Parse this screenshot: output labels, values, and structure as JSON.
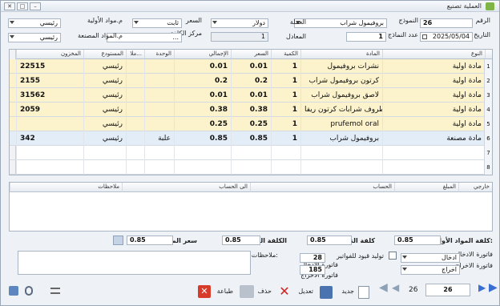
{
  "window": {
    "title": "العملية تصنيع",
    "min": "–",
    "max": "□",
    "close": "✕"
  },
  "header": {
    "number_label": "الرقم",
    "number_value": "26",
    "form_label": "النموذج",
    "form_value": "بروفيمول شراب",
    "date_label": "التاريخ",
    "date_value": "2025/05/04",
    "form_count_label": "عدد النماذج",
    "form_count_value": "1",
    "currency_label": "العملة",
    "currency_value": "دولار",
    "rate_label": "المعادل",
    "rate_value": "1",
    "price_label": "السعر",
    "price_value": "ثابت",
    "cost_center_label": "مركز الكلفة",
    "cost_center_value": "...",
    "raw_store_label": "م.مواد الأولية",
    "raw_store_value": "رئيسي",
    "made_store_label": "م.المواد المصنعة",
    "made_store_value": "رئيسي"
  },
  "grid": {
    "columns": [
      "النوع",
      "المادة",
      "الكمية",
      "السعر",
      "الإجمالي",
      "الوحدة",
      "ملا...",
      "المستودع",
      "المخزون"
    ],
    "rows": [
      {
        "n": "1",
        "type": "مادة اولية",
        "item": "نشرات بروفيمول",
        "qty": "1",
        "price": "0.01",
        "total": "0.01",
        "unit": "",
        "store": "رئيسي",
        "stock": "22515"
      },
      {
        "n": "2",
        "type": "مادة اولية",
        "item": "كرتون بروفيمول شراب",
        "qty": "1",
        "price": "0.2",
        "total": "0.2",
        "unit": "",
        "store": "رئيسي",
        "stock": "2155"
      },
      {
        "n": "3",
        "type": "مادة اولية",
        "item": "لاصق بروفيمول شراب",
        "qty": "1",
        "price": "0.01",
        "total": "0.01",
        "unit": "",
        "store": "رئيسي",
        "stock": "31562"
      },
      {
        "n": "4",
        "type": "مادة اولية",
        "item": "طروف شرابات كرتون ريفا",
        "qty": "1",
        "price": "0.38",
        "total": "0.38",
        "unit": "",
        "store": "رئيسي",
        "stock": "2059"
      },
      {
        "n": "5",
        "type": "مادة اولية",
        "item": "prufemol oral",
        "qty": "1",
        "price": "0.25",
        "total": "0.25",
        "unit": "",
        "store": "رئيسي",
        "stock": ""
      },
      {
        "n": "6",
        "type": "مادة مصنعة",
        "item": "بروفيمول شراب",
        "qty": "1",
        "price": "0.85",
        "total": "0.85",
        "unit": "علبة",
        "store": "رئيسي",
        "stock": "342"
      },
      {
        "n": "7",
        "type": "",
        "item": "",
        "qty": "",
        "price": "",
        "total": "",
        "unit": "",
        "store": "",
        "stock": ""
      },
      {
        "n": "8",
        "type": "",
        "item": "",
        "qty": "",
        "price": "",
        "total": "",
        "unit": "",
        "store": "",
        "stock": ""
      }
    ]
  },
  "grid2": {
    "columns": [
      "خارجي",
      "المبلغ",
      "الحساب",
      "الى الحساب",
      "ملاحظات"
    ]
  },
  "totals": {
    "raw_cost_label": "كلفة المواد الأولية:",
    "raw_cost_value": "0.85",
    "mfg_cost_label": "كلفة التصنيع",
    "mfg_cost_value": "0.85",
    "final_cost_label": "الكلفة النهائية",
    "final_cost_value": "0.85",
    "sale_price_label": "سعر المبيع",
    "sale_price_value": "0.85"
  },
  "footer": {
    "in_invoice_label": "فاتورة الادخال",
    "in_invoice_value": "ادخال",
    "out_invoice_label": "فاتورة الاخراج",
    "out_invoice_value": "اخراج",
    "gen_entries_label": "توليد قيود للفواتير",
    "in_num_label": "فاتورة الادخال",
    "in_num_value": "28",
    "out_num_label": "فاتورة الاخراج",
    "out_num_value": "185",
    "notes_label": "ملاحظات:"
  },
  "toolbar": {
    "new": "جديد",
    "edit": "تعديل",
    "delete": "حذف",
    "print": "طباعة",
    "record_of": "26",
    "record_input": "26"
  }
}
